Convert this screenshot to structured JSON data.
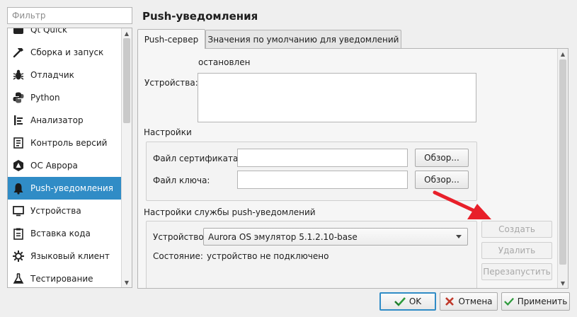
{
  "filter": {
    "placeholder": "Фильтр"
  },
  "sidebar": {
    "items": [
      {
        "label": "Qt Quick",
        "icon": "qt-quick-icon"
      },
      {
        "label": "Сборка и запуск",
        "icon": "hammer-icon"
      },
      {
        "label": "Отладчик",
        "icon": "bug-icon"
      },
      {
        "label": "Python",
        "icon": "python-icon"
      },
      {
        "label": "Анализатор",
        "icon": "analyzer-icon"
      },
      {
        "label": "Контроль версий",
        "icon": "version-control-icon"
      },
      {
        "label": "ОС Аврора",
        "icon": "aurora-icon"
      },
      {
        "label": "Push-уведомления",
        "icon": "bell-icon",
        "selected": true
      },
      {
        "label": "Устройства",
        "icon": "monitor-icon"
      },
      {
        "label": "Вставка кода",
        "icon": "clipboard-icon"
      },
      {
        "label": "Языковый клиент",
        "icon": "language-client-icon"
      },
      {
        "label": "Тестирование",
        "icon": "flask-icon"
      }
    ]
  },
  "page": {
    "title": "Push-уведомления"
  },
  "tabs": [
    {
      "label": "Push-сервер",
      "active": true
    },
    {
      "label": "Значения по умолчанию для уведомлений",
      "active": false
    }
  ],
  "server": {
    "status": "остановлен",
    "devices_label": "Устройства:"
  },
  "settings": {
    "title": "Настройки",
    "cert_label": "Файл сертификата:",
    "cert_value": "",
    "key_label": "Файл ключа:",
    "key_value": "",
    "browse_label": "Обзор..."
  },
  "service": {
    "title": "Настройки службы push-уведомлений",
    "device_label": "Устройство:",
    "device_value": "Aurora OS эмулятор 5.1.2.10-base",
    "state_label": "Состояние:",
    "state_value": "устройство не подключено",
    "create_label": "Создать",
    "delete_label": "Удалить",
    "restart_label": "Перезапустить"
  },
  "dialog": {
    "ok_label": "OK",
    "cancel_label": "Отмена",
    "apply_label": "Применить"
  },
  "colors": {
    "selection": "#308cc6",
    "annotation_arrow": "#e8202a",
    "ok_icon": "#2e9a3c",
    "cancel_icon": "#c0392b"
  }
}
